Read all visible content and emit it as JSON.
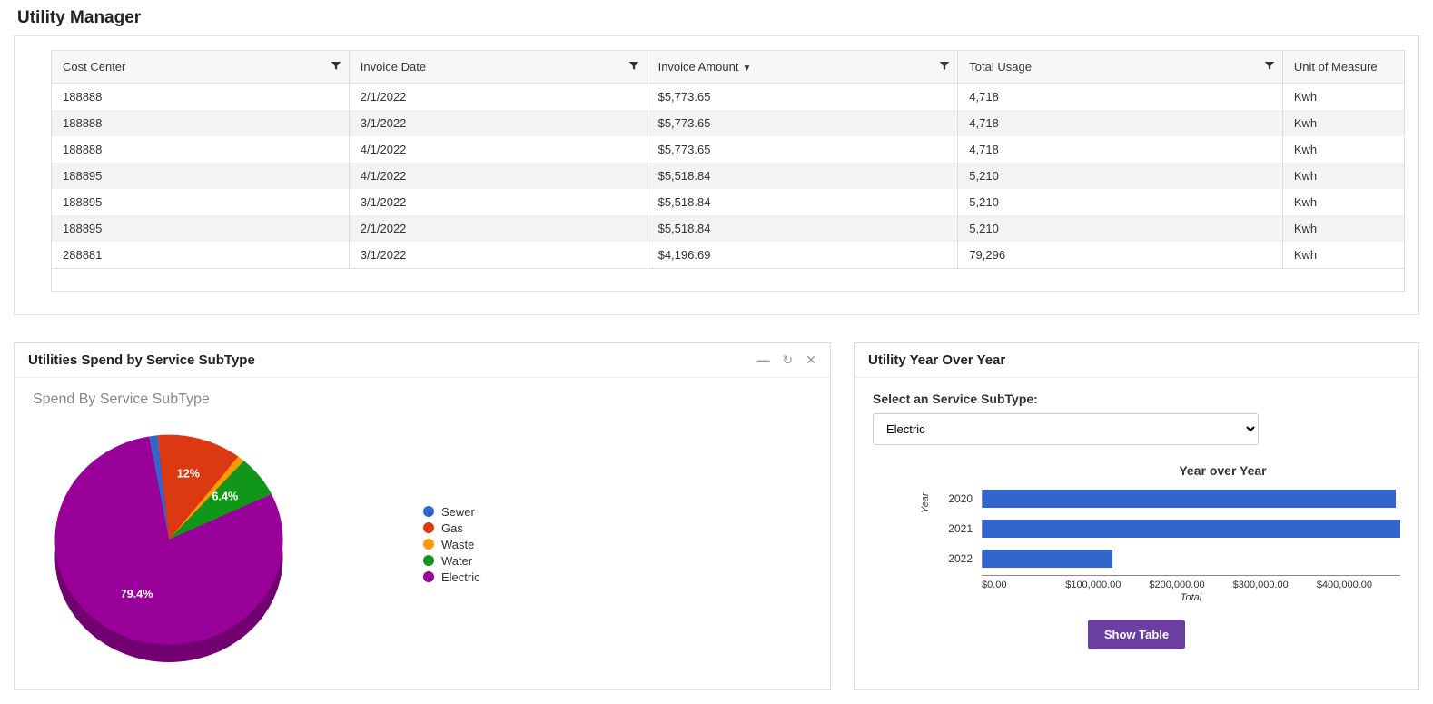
{
  "page_title": "Utility Manager",
  "grid": {
    "columns": [
      {
        "label": "Cost Center",
        "filter": true
      },
      {
        "label": "Invoice Date",
        "filter": true
      },
      {
        "label": "Invoice Amount",
        "filter": true,
        "sorted_desc": true
      },
      {
        "label": "Total Usage",
        "filter": true
      },
      {
        "label": "Unit of Measure",
        "filter": false
      }
    ],
    "rows": [
      {
        "cost_center": "188888",
        "invoice_date": "2/1/2022",
        "invoice_amount": "$5,773.65",
        "total_usage": "4,718",
        "uom": "Kwh"
      },
      {
        "cost_center": "188888",
        "invoice_date": "3/1/2022",
        "invoice_amount": "$5,773.65",
        "total_usage": "4,718",
        "uom": "Kwh"
      },
      {
        "cost_center": "188888",
        "invoice_date": "4/1/2022",
        "invoice_amount": "$5,773.65",
        "total_usage": "4,718",
        "uom": "Kwh"
      },
      {
        "cost_center": "188895",
        "invoice_date": "4/1/2022",
        "invoice_amount": "$5,518.84",
        "total_usage": "5,210",
        "uom": "Kwh"
      },
      {
        "cost_center": "188895",
        "invoice_date": "3/1/2022",
        "invoice_amount": "$5,518.84",
        "total_usage": "5,210",
        "uom": "Kwh"
      },
      {
        "cost_center": "188895",
        "invoice_date": "2/1/2022",
        "invoice_amount": "$5,518.84",
        "total_usage": "5,210",
        "uom": "Kwh"
      },
      {
        "cost_center": "288881",
        "invoice_date": "3/1/2022",
        "invoice_amount": "$4,196.69",
        "total_usage": "79,296",
        "uom": "Kwh"
      }
    ]
  },
  "spend_card": {
    "title": "Utilities Spend by Service SubType",
    "subtitle": "Spend By Service SubType"
  },
  "yoy_card": {
    "title": "Utility Year Over Year",
    "select_label": "Select an Service SubType:",
    "select_value": "Electric",
    "button_label": "Show Table"
  },
  "chart_data": [
    {
      "type": "pie",
      "title": "Spend By Service SubType",
      "series": [
        {
          "name": "Sewer",
          "value": 1.2,
          "color": "#3366cc"
        },
        {
          "name": "Gas",
          "value": 12.0,
          "color": "#dc3912",
          "label": "12%"
        },
        {
          "name": "Waste",
          "value": 1.0,
          "color": "#ff9900"
        },
        {
          "name": "Water",
          "value": 6.4,
          "color": "#109618",
          "label": "6.4%"
        },
        {
          "name": "Electric",
          "value": 79.4,
          "color": "#990099",
          "label": "79.4%"
        }
      ]
    },
    {
      "type": "bar",
      "orientation": "horizontal",
      "title": "Year over Year",
      "xlabel": "Total",
      "ylabel": "Year",
      "xlim": [
        0,
        450000
      ],
      "xticks": [
        "$0.00",
        "$100,000.00",
        "$200,000.00",
        "$300,000.00",
        "$400,000.00"
      ],
      "categories": [
        "2020",
        "2021",
        "2022"
      ],
      "values": [
        445000,
        450000,
        140000
      ],
      "color": "#3366cc"
    }
  ]
}
